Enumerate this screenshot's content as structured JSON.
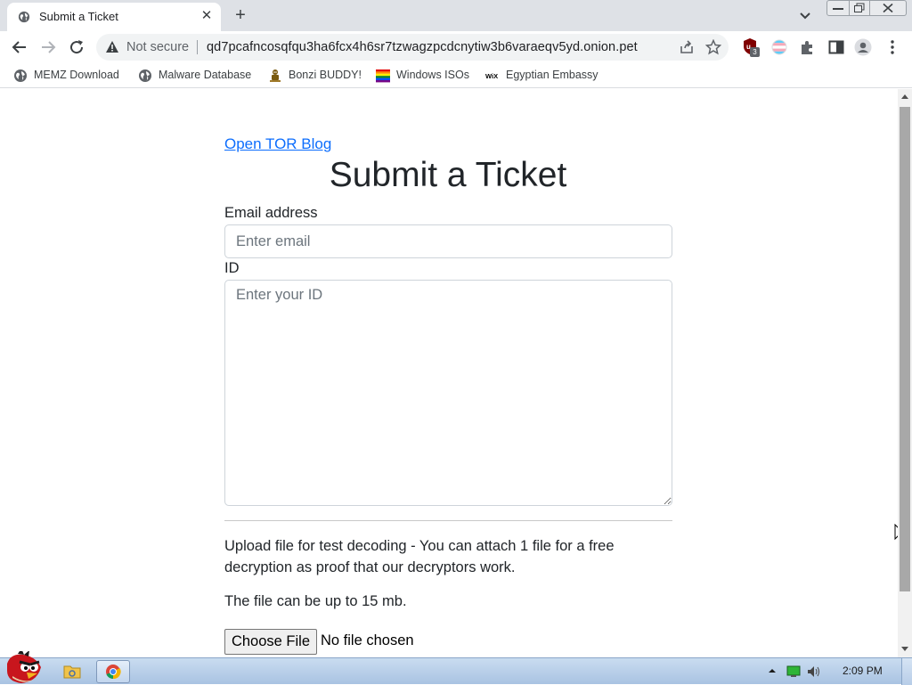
{
  "browser": {
    "tab": {
      "title": "Submit a Ticket"
    },
    "address_bar": {
      "security_label": "Not secure",
      "url": "qd7pcafncosqfqu3ha6fcx4h6sr7tzwagzpcdcnytiw3b6varaeqv5yd.onion.pet"
    },
    "extensions": {
      "ublock_badge": "3"
    },
    "bookmarks": [
      {
        "label": "MEMZ Download",
        "icon": "globe-icon"
      },
      {
        "label": "Malware Database",
        "icon": "globe-icon"
      },
      {
        "label": "Bonzi BUDDY!",
        "icon": "bonzi-icon"
      },
      {
        "label": "Windows ISOs",
        "icon": "rainbow-flag-icon"
      },
      {
        "label": "Egyptian Embassy",
        "icon": "wix-icon"
      }
    ]
  },
  "page": {
    "blog_link": "Open TOR Blog",
    "heading": "Submit a Ticket",
    "email": {
      "label": "Email address",
      "placeholder": "Enter email",
      "value": ""
    },
    "id_field": {
      "label": "ID",
      "placeholder": "Enter your ID",
      "value": ""
    },
    "upload_text": "Upload file for test decoding - You can attach 1 file for a free decryption as proof that our decryptors work.",
    "size_text": "The file can be up to 15 mb.",
    "choose_file_label": "Choose File",
    "no_file_text": "No file chosen"
  },
  "taskbar": {
    "clock": "2:09 PM"
  },
  "colors": {
    "link": "#0d6efd",
    "text": "#212529",
    "placeholder": "#6c757d",
    "tabstrip": "#dee1e6",
    "omnibox": "#f1f3f4"
  }
}
